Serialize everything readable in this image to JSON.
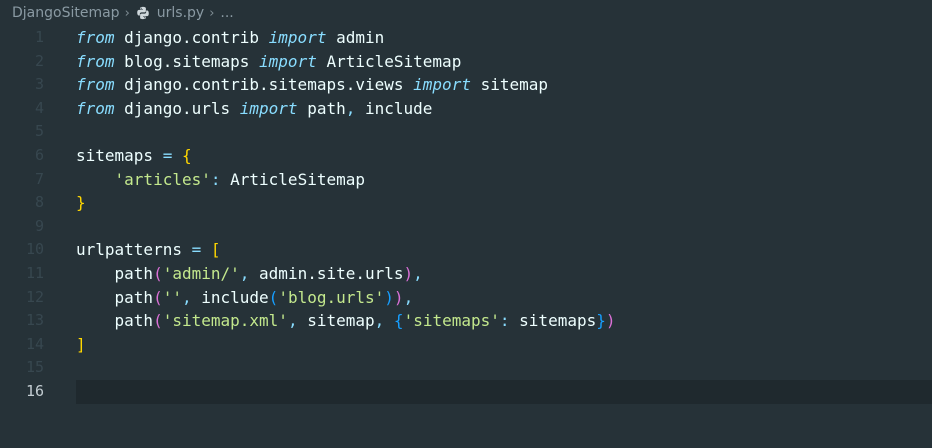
{
  "breadcrumb": {
    "project": "DjangoSitemap",
    "file": "urls.py",
    "more": "...",
    "separator": "›"
  },
  "editor": {
    "current_line": 16,
    "lines": [
      {
        "n": "1",
        "tokens": [
          {
            "t": "from",
            "c": "kw"
          },
          {
            "t": " django.contrib ",
            "c": "plain"
          },
          {
            "t": "import",
            "c": "kw"
          },
          {
            "t": " admin",
            "c": "plain"
          }
        ]
      },
      {
        "n": "2",
        "tokens": [
          {
            "t": "from",
            "c": "kw"
          },
          {
            "t": " blog.sitemaps ",
            "c": "plain"
          },
          {
            "t": "import",
            "c": "kw"
          },
          {
            "t": " ArticleSitemap",
            "c": "plain"
          }
        ]
      },
      {
        "n": "3",
        "tokens": [
          {
            "t": "from",
            "c": "kw"
          },
          {
            "t": " django.contrib.sitemaps.views ",
            "c": "plain"
          },
          {
            "t": "import",
            "c": "kw"
          },
          {
            "t": " sitemap",
            "c": "plain"
          }
        ]
      },
      {
        "n": "4",
        "tokens": [
          {
            "t": "from",
            "c": "kw"
          },
          {
            "t": " django.urls ",
            "c": "plain"
          },
          {
            "t": "import",
            "c": "kw"
          },
          {
            "t": " path",
            "c": "plain"
          },
          {
            "t": ",",
            "c": "punct"
          },
          {
            "t": " include",
            "c": "plain"
          }
        ]
      },
      {
        "n": "5",
        "tokens": []
      },
      {
        "n": "6",
        "tokens": [
          {
            "t": "sitemaps ",
            "c": "plain"
          },
          {
            "t": "=",
            "c": "punct"
          },
          {
            "t": " ",
            "c": "plain"
          },
          {
            "t": "{",
            "c": "brace"
          }
        ]
      },
      {
        "n": "7",
        "tokens": [
          {
            "t": "    ",
            "c": "plain"
          },
          {
            "t": "'articles'",
            "c": "str"
          },
          {
            "t": ":",
            "c": "punct"
          },
          {
            "t": " ArticleSitemap",
            "c": "plain"
          }
        ]
      },
      {
        "n": "8",
        "tokens": [
          {
            "t": "}",
            "c": "brace"
          }
        ]
      },
      {
        "n": "9",
        "tokens": []
      },
      {
        "n": "10",
        "tokens": [
          {
            "t": "urlpatterns ",
            "c": "plain"
          },
          {
            "t": "=",
            "c": "punct"
          },
          {
            "t": " ",
            "c": "plain"
          },
          {
            "t": "[",
            "c": "brace"
          }
        ]
      },
      {
        "n": "11",
        "tokens": [
          {
            "t": "    path",
            "c": "plain"
          },
          {
            "t": "(",
            "c": "brace2"
          },
          {
            "t": "'admin/'",
            "c": "str"
          },
          {
            "t": ",",
            "c": "punct"
          },
          {
            "t": " admin.site.urls",
            "c": "plain"
          },
          {
            "t": ")",
            "c": "brace2"
          },
          {
            "t": ",",
            "c": "punct"
          }
        ]
      },
      {
        "n": "12",
        "tokens": [
          {
            "t": "    path",
            "c": "plain"
          },
          {
            "t": "(",
            "c": "brace2"
          },
          {
            "t": "''",
            "c": "str"
          },
          {
            "t": ",",
            "c": "punct"
          },
          {
            "t": " include",
            "c": "plain"
          },
          {
            "t": "(",
            "c": "brace3"
          },
          {
            "t": "'blog.urls'",
            "c": "str"
          },
          {
            "t": ")",
            "c": "brace3"
          },
          {
            "t": ")",
            "c": "brace2"
          },
          {
            "t": ",",
            "c": "punct"
          }
        ]
      },
      {
        "n": "13",
        "tokens": [
          {
            "t": "    path",
            "c": "plain"
          },
          {
            "t": "(",
            "c": "brace2"
          },
          {
            "t": "'sitemap.xml'",
            "c": "str"
          },
          {
            "t": ",",
            "c": "punct"
          },
          {
            "t": " sitemap",
            "c": "plain"
          },
          {
            "t": ",",
            "c": "punct"
          },
          {
            "t": " ",
            "c": "plain"
          },
          {
            "t": "{",
            "c": "brace3"
          },
          {
            "t": "'sitemaps'",
            "c": "str"
          },
          {
            "t": ":",
            "c": "punct"
          },
          {
            "t": " sitemaps",
            "c": "plain"
          },
          {
            "t": "}",
            "c": "brace3"
          },
          {
            "t": ")",
            "c": "brace2"
          }
        ]
      },
      {
        "n": "14",
        "tokens": [
          {
            "t": "]",
            "c": "brace"
          }
        ]
      },
      {
        "n": "15",
        "tokens": []
      },
      {
        "n": "16",
        "tokens": []
      }
    ]
  }
}
